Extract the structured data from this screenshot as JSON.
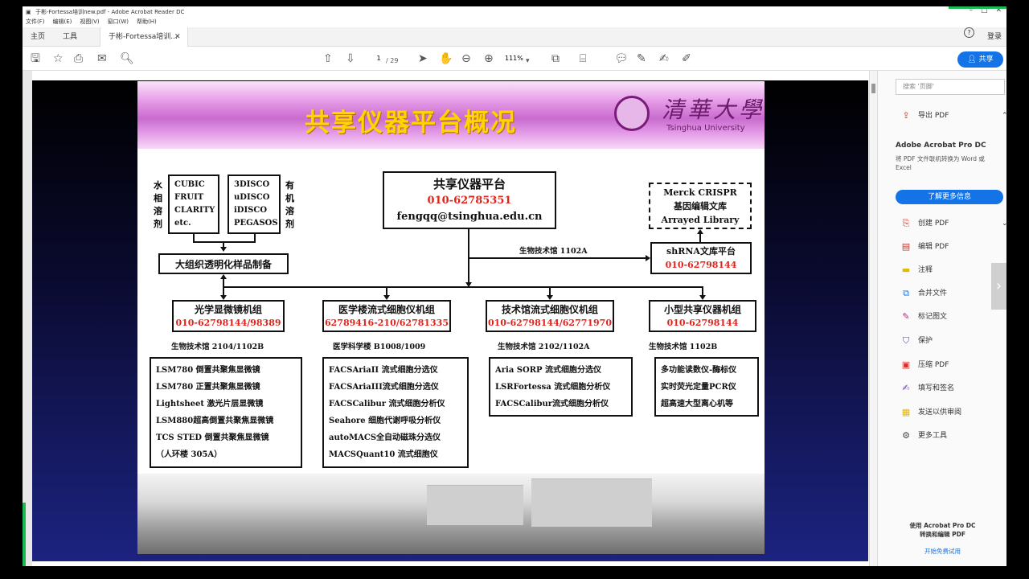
{
  "window": {
    "title": "于彬-Fortessa培训new.pdf - Adobe Acrobat Reader DC"
  },
  "menu": [
    "文件(F)",
    "编辑(E)",
    "视图(V)",
    "窗口(W)",
    "帮助(H)"
  ],
  "tabs": {
    "home": "主页",
    "tools": "工具",
    "doc": "于彬-Fortessa培训...",
    "signin": "登录"
  },
  "toolbar": {
    "page": "1",
    "total": "/ 29",
    "zoom": "111%",
    "share": "共享"
  },
  "slide": {
    "title": "共享仪器平台概况",
    "logo_cn": "清華大學",
    "logo_en": "Tsinghua University",
    "hub": {
      "name": "共享仪器平台",
      "phone": "010-62785351",
      "email": "fengqq@tsinghua.edu.cn"
    },
    "water_label": "水相溶剂",
    "organic_label": "有机溶剂",
    "water_methods": [
      "CUBIC",
      "FRUIT",
      "CLARITY",
      "etc."
    ],
    "organic_methods": [
      "3DISCO",
      "uDISCO",
      "iDISCO",
      "PEGASOS"
    ],
    "prep": "大组织透明化样品制备",
    "crispr": [
      "Merck CRISPR",
      "基因编辑文库",
      "Arrayed  Library"
    ],
    "route_label": "生物技术馆  1102A",
    "shrna": {
      "name": "shRNA文库平台",
      "phone": "010-62798144"
    },
    "groups": [
      {
        "name": "光学显微镜机组",
        "phone": "010-62798144/98389",
        "loc": "生物技术馆   2104/1102B",
        "items": [
          "LSM780 倒置共聚焦显微镜",
          "LSM780 正置共聚焦显微镜",
          "Lightsheet 激光片层显微镜",
          "LSM880超高倒置共聚焦显微镜",
          "TCS STED 倒置共聚焦显微镜",
          "（人环楼 305A）"
        ]
      },
      {
        "name": "医学楼流式细胞仪机组",
        "phone": "62789416-210/62781335",
        "loc": "医学科学楼   B1008/1009",
        "items": [
          "FACSAriaII 流式细胞分选仪",
          "FACSAriaIII流式细胞分选仪",
          "FACSCalibur 流式细胞分析仪",
          "Seahore 细胞代谢呼吸分析仪",
          "autoMACS全自动磁珠分选仪",
          "MACSQuant10 流式细胞仪"
        ]
      },
      {
        "name": "技术馆流式细胞仪机组",
        "phone": "010-62798144/62771970",
        "loc": "生物技术馆   2102/1102A",
        "items": [
          "Aria SORP 流式细胞分选仪",
          "LSRFortessa 流式细胞分析仪",
          "FACSCalibur流式细胞分析仪"
        ]
      },
      {
        "name": "小型共享仪器机组",
        "phone": "010-62798144",
        "loc": "生物技术馆   1102B",
        "items": [
          "多功能读数仪-酶标仪",
          "实时荧光定量PCR仪",
          "超高速大型离心机等"
        ]
      }
    ]
  },
  "panel": {
    "search": "搜索 '页脚'",
    "export": "导出 PDF",
    "promo_title": "Adobe Acrobat Pro DC",
    "promo_text": "将 PDF 文件联机转换为 Word 或 Excel",
    "learn": "了解更多信息",
    "tools": [
      "创建 PDF",
      "编辑 PDF",
      "注释",
      "合并文件",
      "标记图文",
      "保护",
      "压缩 PDF",
      "填写和签名",
      "发送以供审阅",
      "更多工具"
    ],
    "footer1": "使用 Acrobat Pro DC",
    "footer2": "转换和编辑 PDF",
    "trial": "开始免费试用"
  }
}
